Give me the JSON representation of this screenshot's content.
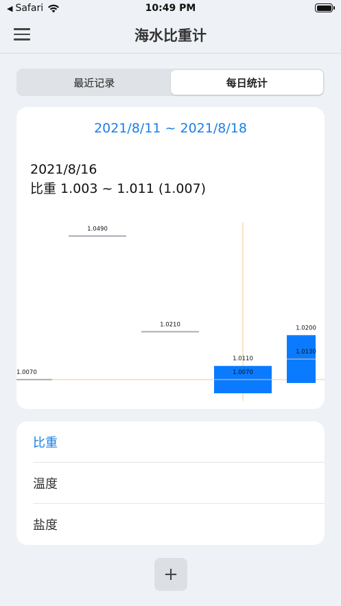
{
  "status_bar": {
    "back_arrow": "◀",
    "carrier": "Safari",
    "time": "10:49 PM"
  },
  "nav": {
    "title": "海水比重计"
  },
  "tabs": [
    {
      "label": "最近记录",
      "active": false
    },
    {
      "label": "每日统计",
      "active": true
    }
  ],
  "chart": {
    "date_range": "2021/8/11  ~  2021/8/18",
    "selected_date": "2021/8/16",
    "selected_summary": "比重 1.003 ~ 1.011 (1.007)"
  },
  "chart_data": {
    "type": "candlestick",
    "ylim": [
      1.0,
      1.055
    ],
    "series": [
      {
        "low": 1.007,
        "high": 1.007,
        "avg": 1.007,
        "labels": [
          "1.0070"
        ]
      },
      {
        "low": 1.049,
        "high": 1.049,
        "avg": 1.049,
        "labels": [
          "1.0490"
        ]
      },
      {
        "low": 1.021,
        "high": 1.021,
        "avg": 1.021,
        "labels": [
          "1.0210"
        ]
      },
      {
        "low": 1.003,
        "high": 1.011,
        "avg": 1.007,
        "labels": [
          "1.0110",
          "1.0070"
        ]
      },
      {
        "low": 1.006,
        "high": 1.02,
        "avg": 1.013,
        "labels": [
          "1.0200",
          "1.0130"
        ]
      }
    ],
    "selected_index": 3,
    "colors": {
      "range_bar": "#0a7bff",
      "flat_line": "#a7aeb6",
      "avg_line": "#a7aeb6",
      "crosshair": "#f5c98a"
    }
  },
  "list": [
    {
      "label": "比重",
      "active": true
    },
    {
      "label": "温度",
      "active": false
    },
    {
      "label": "盐度",
      "active": false
    }
  ],
  "add_button": {
    "icon": "plus-icon",
    "symbol": "+"
  }
}
